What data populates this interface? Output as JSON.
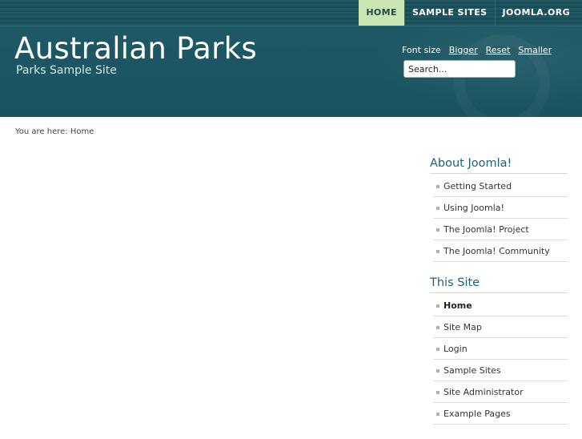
{
  "topnav": {
    "items": [
      {
        "label": "HOME"
      },
      {
        "label": "SAMPLE SITES"
      },
      {
        "label": "JOOMLA.ORG"
      }
    ]
  },
  "header": {
    "title": "Australian Parks",
    "subtitle": "Parks Sample Site"
  },
  "fontsize": {
    "label": "Font size",
    "bigger": "Bigger",
    "reset": "Reset",
    "smaller": "Smaller"
  },
  "search": {
    "value": "Search..."
  },
  "breadcrumb": {
    "text": "You are here: Home"
  },
  "sidebar": {
    "about": {
      "title": "About Joomla!",
      "items": [
        "Getting Started",
        "Using Joomla!",
        "The Joomla! Project",
        "The Joomla! Community"
      ]
    },
    "thissite": {
      "title": "This Site",
      "items": [
        "Home",
        "Site Map",
        "Login",
        "Sample Sites",
        "Site Administrator",
        "Example Pages"
      ]
    }
  },
  "colors": {
    "header_bg": "#1e5966",
    "active_tab": "#c9e6b3",
    "module_title": "#1c6275"
  }
}
